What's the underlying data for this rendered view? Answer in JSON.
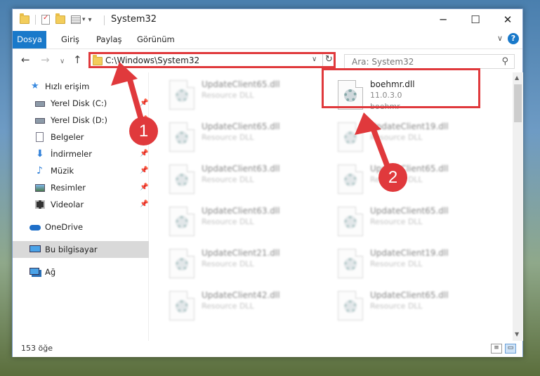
{
  "window": {
    "title": "System32",
    "controls": {
      "minimize": "─",
      "maximize": "☐",
      "close": "✕"
    }
  },
  "ribbon": {
    "tabs": [
      "Dosya",
      "Giriş",
      "Paylaş",
      "Görünüm"
    ],
    "help": "?",
    "collapse": "∨"
  },
  "nav_buttons": {
    "back": "←",
    "forward": "→",
    "recent": "∨",
    "up": "↑"
  },
  "address": {
    "path": "C:\\Windows\\System32",
    "dropdown": "∨",
    "refresh": "↻"
  },
  "search": {
    "placeholder": "Ara: System32",
    "icon": "⚲"
  },
  "sidebar": {
    "items": [
      {
        "label": "Hızlı erişim",
        "icon": "star-icon",
        "pinned": false
      },
      {
        "label": "Yerel Disk (C:)",
        "icon": "drive-icon",
        "pinned": true
      },
      {
        "label": "Yerel Disk (D:)",
        "icon": "drive-icon",
        "pinned": true
      },
      {
        "label": "Belgeler",
        "icon": "document-icon",
        "pinned": true
      },
      {
        "label": "İndirmeler",
        "icon": "download-icon",
        "pinned": true
      },
      {
        "label": "Müzik",
        "icon": "music-icon",
        "pinned": true
      },
      {
        "label": "Resimler",
        "icon": "pictures-icon",
        "pinned": true
      },
      {
        "label": "Videolar",
        "icon": "videos-icon",
        "pinned": true
      },
      {
        "label": "OneDrive",
        "icon": "cloud-icon",
        "pinned": false
      },
      {
        "label": "Bu bilgisayar",
        "icon": "computer-icon",
        "pinned": false,
        "selected": true
      },
      {
        "label": "Ağ",
        "icon": "network-icon",
        "pinned": false
      }
    ],
    "pin_glyph": "📌"
  },
  "files": {
    "left": [
      {
        "name": "UpdateClient65.dll",
        "desc": "Resource DLL"
      },
      {
        "name": "UpdateClient65.dll",
        "desc": "Resource DLL"
      },
      {
        "name": "UpdateClient63.dll",
        "desc": "Resource DLL"
      },
      {
        "name": "UpdateClient63.dll",
        "desc": "Resource DLL"
      },
      {
        "name": "UpdateClient21.dll",
        "desc": "Resource DLL"
      },
      {
        "name": "UpdateClient42.dll",
        "desc": "Resource DLL"
      }
    ],
    "highlighted": {
      "name": "boehmr.dll",
      "version": "11.0.3.0",
      "company": "boehmr"
    },
    "right": [
      {
        "name": "UpdateClient19.dll",
        "desc": "Resource DLL"
      },
      {
        "name": "UpdateClient65.dll",
        "desc": "Resource DLL"
      },
      {
        "name": "UpdateClient65.dll",
        "desc": "Resource DLL"
      },
      {
        "name": "UpdateClient19.dll",
        "desc": "Resource DLL"
      },
      {
        "name": "UpdateClient65.dll",
        "desc": "Resource DLL"
      }
    ]
  },
  "status": {
    "count": "153 öğe"
  },
  "annotations": {
    "badge1": "1",
    "badge2": "2",
    "color": "#e0393c"
  }
}
